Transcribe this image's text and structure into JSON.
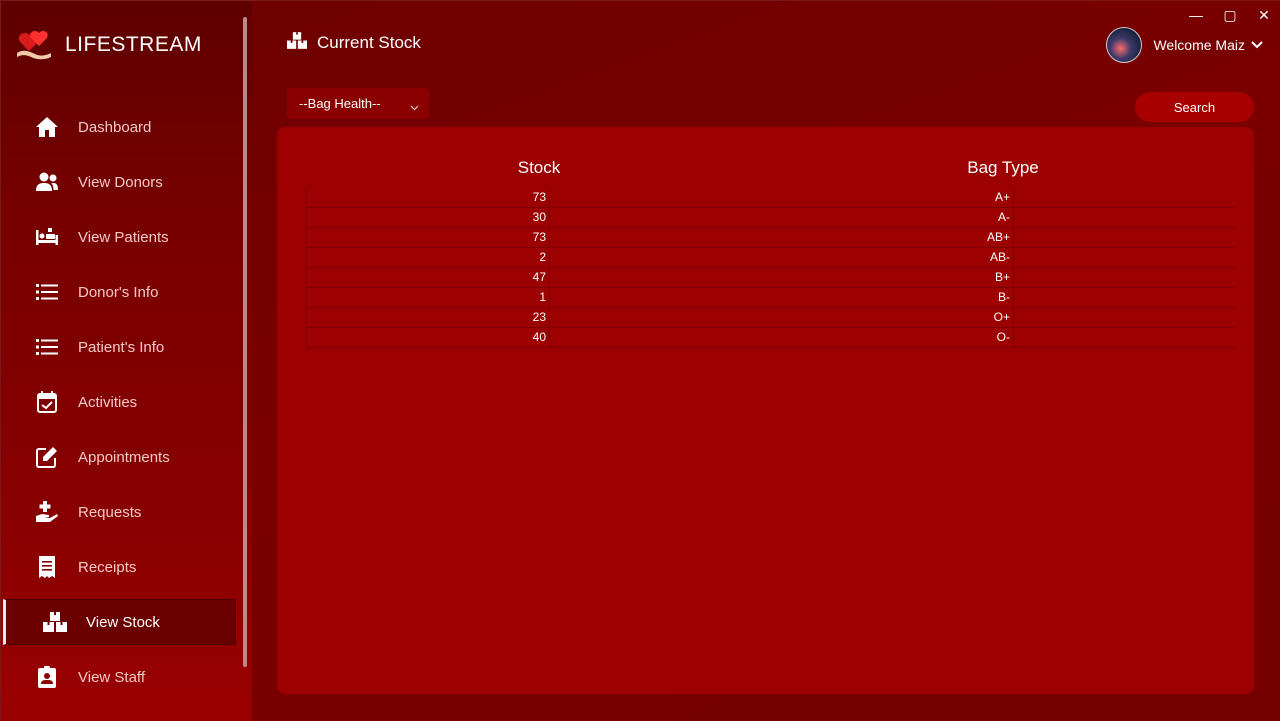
{
  "app": {
    "name": "LIFESTREAM"
  },
  "window_controls": {
    "minimize": "—",
    "maximize": "▢",
    "close": "✕"
  },
  "sidebar": {
    "items": [
      {
        "label": "Dashboard",
        "icon": "home-icon"
      },
      {
        "label": "View Donors",
        "icon": "users-icon"
      },
      {
        "label": "View Patients",
        "icon": "bed-icon"
      },
      {
        "label": "Donor's Info",
        "icon": "list-icon"
      },
      {
        "label": "Patient's Info",
        "icon": "list-icon"
      },
      {
        "label": "Activities",
        "icon": "calendar-check-icon"
      },
      {
        "label": "Appointments",
        "icon": "edit-icon"
      },
      {
        "label": "Requests",
        "icon": "hand-medical-icon"
      },
      {
        "label": "Receipts",
        "icon": "receipt-icon"
      },
      {
        "label": "View Stock",
        "icon": "boxes-icon",
        "active": true
      },
      {
        "label": "View Staff",
        "icon": "id-badge-icon"
      }
    ]
  },
  "header": {
    "title": "Current Stock",
    "welcome": "Welcome Maiz"
  },
  "filter": {
    "selected": "--Bag Health--"
  },
  "search_label": "Search",
  "table": {
    "headers": [
      "Stock",
      "Bag Type"
    ],
    "rows": [
      {
        "stock": "73",
        "bag": "A+"
      },
      {
        "stock": "30",
        "bag": "A-"
      },
      {
        "stock": "73",
        "bag": "AB+"
      },
      {
        "stock": "2",
        "bag": "AB-"
      },
      {
        "stock": "47",
        "bag": "B+"
      },
      {
        "stock": "1",
        "bag": "B-"
      },
      {
        "stock": "23",
        "bag": "O+"
      },
      {
        "stock": "40",
        "bag": "O-"
      }
    ]
  },
  "colors": {
    "accent": "#9c0000",
    "sidebar_text": "#f3c9c9",
    "search_button": "#a80000"
  }
}
